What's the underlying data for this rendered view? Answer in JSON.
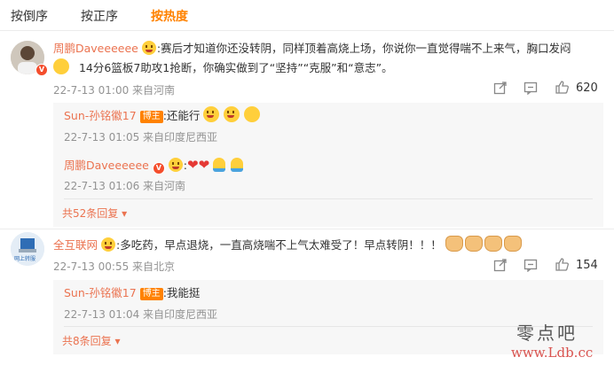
{
  "tabs": [
    "按倒序",
    "按正序",
    "按热度"
  ],
  "comments": [
    {
      "name": "周鹏Daveeeeee",
      "text_line1": ":赛后才知道你还没转阴，同样顶着高烧上场，你说你一直觉得喘不上来气，胸口发闷",
      "text_line2": "14分6篮板7助攻1抢断，你确实做到了“坚持”“克服”和“意志”。",
      "meta": "22-7-13 01:00 来自河南",
      "likes": "620",
      "replies": [
        {
          "name": "Sun-孙铭徽17",
          "badge": "博主",
          "text": ":还能行",
          "meta": "22-7-13 01:05 来自印度尼西亚"
        },
        {
          "name": "周鹏Daveeeeee",
          "text": ":",
          "meta": "22-7-13 01:06 来自河南"
        }
      ],
      "more": "共52条回复"
    },
    {
      "name": "全互联网",
      "avatar_text": "网上转服",
      "text": ":多吃药，早点退烧，一直高烧喘不上气太难受了！早点转阴！！！",
      "meta": "22-7-13 00:55 来自北京",
      "likes": "154",
      "replies": [
        {
          "name": "Sun-孙铭徽17",
          "badge": "博主",
          "text": ":我能挺",
          "meta": "22-7-13 01:04 来自印度尼西亚"
        }
      ],
      "more": "共8条回复"
    }
  ],
  "watermark": {
    "line1": "零点吧",
    "line2": "www.Ldb.cc"
  },
  "colors": {
    "accent": "#ff8200",
    "name": "#eb7350",
    "meta": "#939393"
  }
}
